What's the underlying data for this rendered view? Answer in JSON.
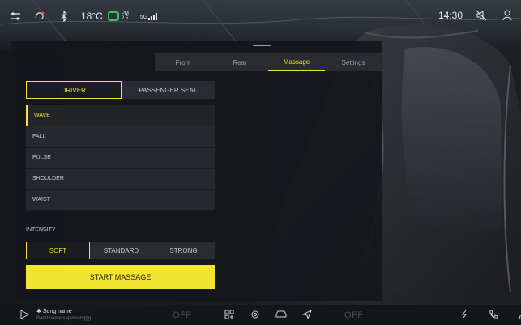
{
  "status": {
    "temperature": "18°C",
    "pm_value": "PM\n2.5",
    "signal": "5G",
    "time": "14:30"
  },
  "tabs": [
    {
      "label": "Front",
      "active": false
    },
    {
      "label": "Rear",
      "active": false
    },
    {
      "label": "Massage",
      "active": true
    },
    {
      "label": "Settings",
      "active": false
    }
  ],
  "seat_select": {
    "driver": "DRIVER",
    "passenger": "PASSENGER SEAT"
  },
  "modes": [
    {
      "label": "WAVE",
      "active": true
    },
    {
      "label": "FALL",
      "active": false
    },
    {
      "label": "PULSE",
      "active": false
    },
    {
      "label": "SHOULDER",
      "active": false
    },
    {
      "label": "WAIST",
      "active": false
    }
  ],
  "intensity": {
    "label": "INTENSITY",
    "options": [
      "SOFT",
      "STANDARD",
      "STRONG"
    ],
    "selected": "SOFT"
  },
  "start_button": "START MASSAGE",
  "bottom": {
    "song_name": "Song name",
    "band_name": "Band name supersonggg",
    "left_off": "OFF",
    "right_off": "OFF"
  },
  "colors": {
    "accent": "#f2e531",
    "panel": "#16171b",
    "pm_leaf": "#37c15a"
  },
  "icons": [
    "settings-sliders-icon",
    "voice-assistant-icon",
    "bluetooth-icon",
    "pm-leaf-icon",
    "signal-icon",
    "mute-icon",
    "user-icon",
    "play-icon",
    "bluetooth-small-icon",
    "apps-grid-icon",
    "gear-icon",
    "car-icon",
    "navigation-icon",
    "seat-heat-icon",
    "phone-icon",
    "music-note-icon"
  ]
}
